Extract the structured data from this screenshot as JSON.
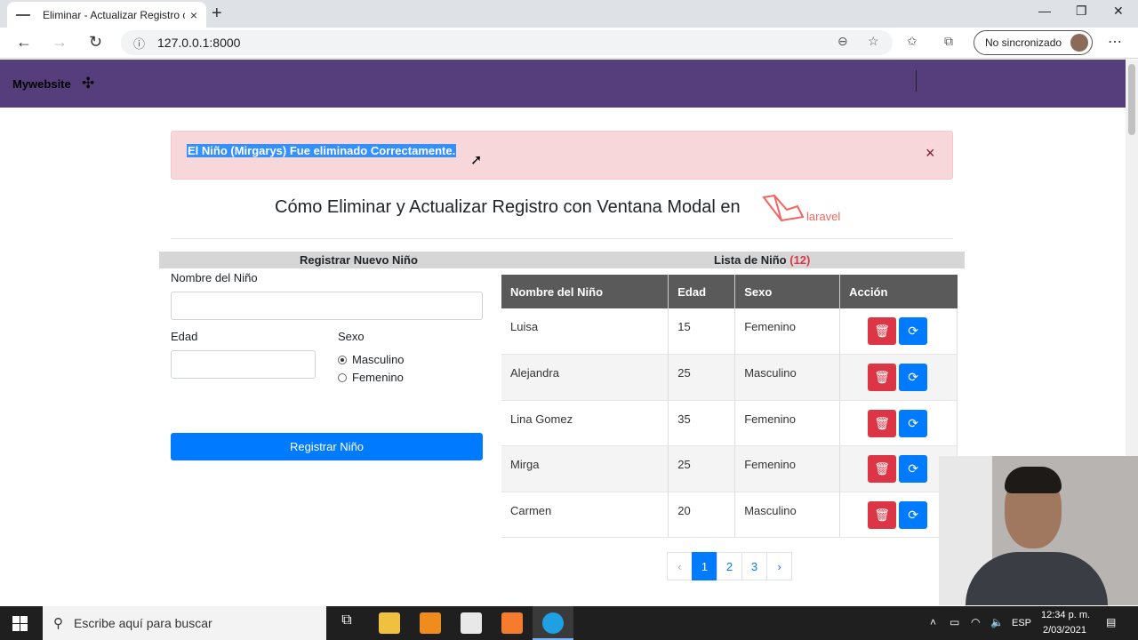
{
  "browser": {
    "tab_title": "Eliminar - Actualizar Registro con",
    "tab_close": "×",
    "new_tab": "+",
    "address": "127.0.0.1:8000",
    "address_info": "ⓘ",
    "sync_label": "No sincronizado",
    "window_controls": {
      "minimize": "—",
      "maximize": "❐",
      "close": "✕"
    },
    "nav": {
      "back": "←",
      "forward": "→",
      "reload": "↻"
    }
  },
  "site": {
    "brand": "Mywebsite",
    "brand_logo": "✣"
  },
  "alert": {
    "message": "El Niño (Mirgarys) Fue eliminado Correctamente.",
    "close": "×"
  },
  "page": {
    "title": "Cómo Eliminar y Actualizar Registro con Ventana Modal en",
    "framework_logo_text": "laravel"
  },
  "form": {
    "heading": "Registrar Nuevo Niño",
    "name_label": "Nombre del Niño",
    "name_value": "",
    "age_label": "Edad",
    "age_value": "",
    "sex_label": "Sexo",
    "sex_options": [
      {
        "label": "Masculino",
        "checked": true
      },
      {
        "label": "Femenino",
        "checked": false
      }
    ],
    "submit_label": "Registrar Niño"
  },
  "list": {
    "heading": "Lista de Niño",
    "count": "(12)",
    "columns": [
      "Nombre del Niño",
      "Edad",
      "Sexo",
      "Acción"
    ],
    "rows": [
      {
        "name": "Luisa",
        "age": "15",
        "sex": "Femenino"
      },
      {
        "name": "Alejandra",
        "age": "25",
        "sex": "Masculino"
      },
      {
        "name": "Lina Gomez",
        "age": "35",
        "sex": "Femenino"
      },
      {
        "name": "Mirga",
        "age": "25",
        "sex": "Femenino"
      },
      {
        "name": "Carmen",
        "age": "20",
        "sex": "Masculino"
      }
    ],
    "delete_icon": "trash-icon",
    "update_icon": "refresh-icon"
  },
  "pagination": {
    "prev": "‹",
    "pages": [
      "1",
      "2",
      "3"
    ],
    "active_page": "1",
    "next": "›"
  },
  "taskbar": {
    "search_placeholder": "Escribe aquí para buscar",
    "language": "ESP",
    "time": "12:34 p. m.",
    "date": "2/03/2021"
  },
  "colors": {
    "header": "#563d7c",
    "alert_bg": "#f8d7da",
    "primary": "#007bff",
    "danger": "#dc3545",
    "table_head": "#5a5a5a"
  }
}
